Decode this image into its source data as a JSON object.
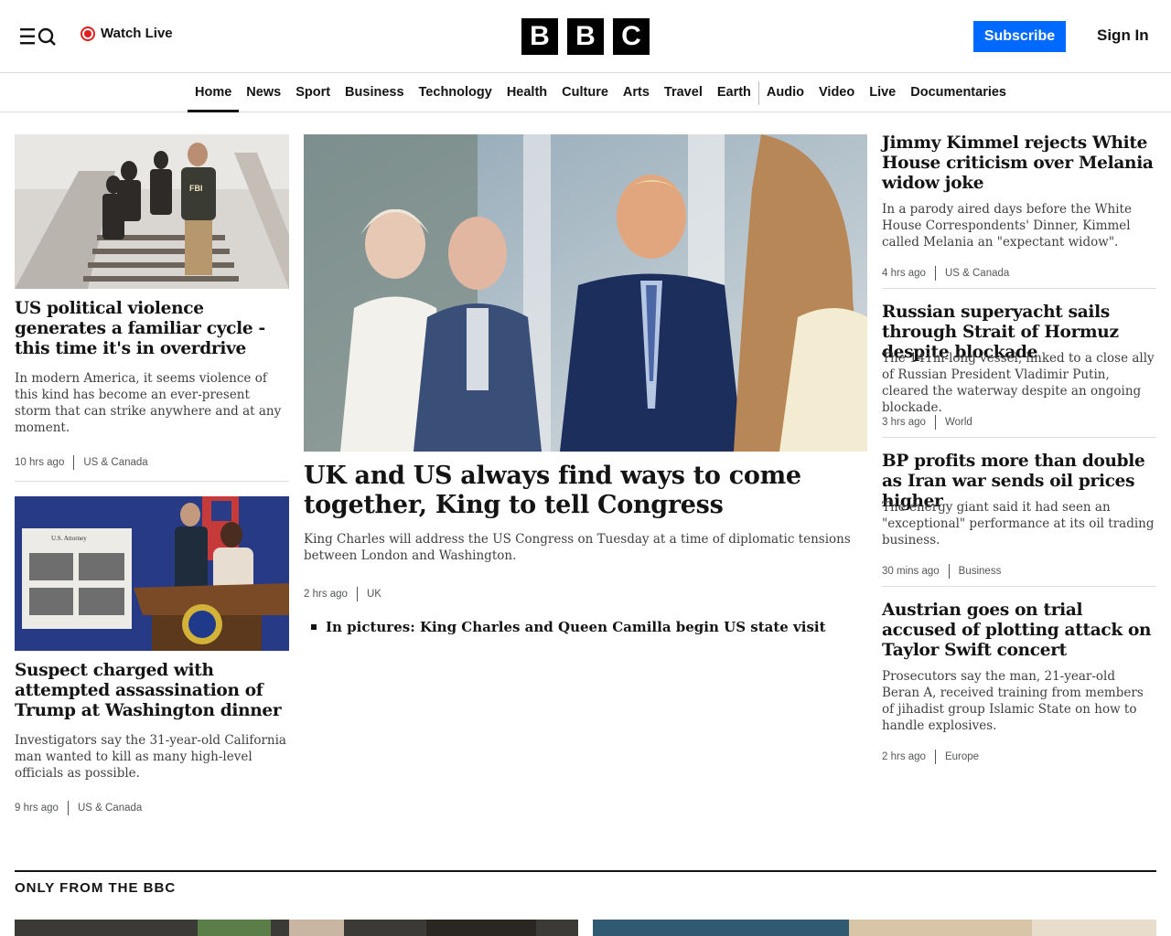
{
  "header": {
    "watch_live": "Watch Live",
    "logo_letters": [
      "B",
      "B",
      "C"
    ],
    "subscribe": "Subscribe",
    "sign_in": "Sign In"
  },
  "nav": {
    "items": [
      "Home",
      "News",
      "Sport",
      "Business",
      "Technology",
      "Health",
      "Culture",
      "Arts",
      "Travel",
      "Earth",
      "Audio",
      "Video",
      "Live",
      "Documentaries"
    ],
    "active": "Home"
  },
  "left": [
    {
      "headline": "US political violence generates a familiar cycle - this time it's in overdrive",
      "summary": "In modern America, it seems violence of this kind has become an ever-present storm that can strike anywhere and at any moment.",
      "time": "10 hrs ago",
      "section": "US & Canada"
    },
    {
      "headline": "Suspect charged with attempted assassination of Trump at Washington dinner",
      "summary": "Investigators say the 31-year-old California man wanted to kill as many high-level officials as possible.",
      "time": "9 hrs ago",
      "section": "US & Canada"
    }
  ],
  "main": {
    "headline": "UK and US always find ways to come together, King to tell Congress",
    "summary": "King Charles will address the US Congress on Tuesday at a time of diplomatic tensions between London and Washington.",
    "time": "2 hrs ago",
    "section": "UK",
    "related": "In pictures: King Charles and Queen Camilla begin US state visit"
  },
  "right": [
    {
      "headline": "Jimmy Kimmel rejects White House criticism over Melania widow joke",
      "summary": "In a parody aired days before the White House Correspondents' Dinner, Kimmel called Melania an \"expectant widow\".",
      "time": "4 hrs ago",
      "section": "US & Canada"
    },
    {
      "headline": "Russian superyacht sails through Strait of Hormuz despite blockade",
      "summary": "The 141m-long vessel, linked to a close ally of Russian President Vladimir Putin, cleared the waterway despite an ongoing blockade.",
      "time": "3 hrs ago",
      "section": "World"
    },
    {
      "headline": "BP profits more than double as Iran war sends oil prices higher",
      "summary": "The energy giant said it had seen an \"exceptional\" performance at its oil trading business.",
      "time": "30 mins ago",
      "section": "Business"
    },
    {
      "headline": "Austrian goes on trial accused of plotting attack on Taylor Swift concert",
      "summary": "Prosecutors say the man, 21-year-old Beran A, received training from members of jihadist group Islamic State on how to handle explosives.",
      "time": "2 hrs ago",
      "section": "Europe"
    }
  ],
  "only_from": {
    "title": "ONLY FROM THE BBC"
  },
  "icons": {
    "menu": "menu-icon",
    "search": "search-icon",
    "live": "live-indicator-icon"
  },
  "colors": {
    "subscribe": "#0069ff",
    "live": "#e01e1e",
    "text": "#141414"
  }
}
